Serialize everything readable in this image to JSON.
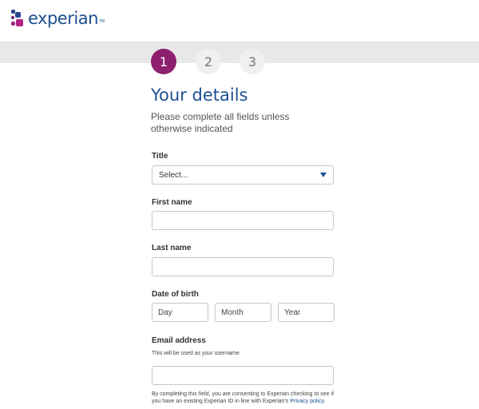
{
  "brand": {
    "name": "experian",
    "trademark": "TM"
  },
  "steps": [
    {
      "label": "1",
      "state": "active"
    },
    {
      "label": "2",
      "state": "inactive"
    },
    {
      "label": "3",
      "state": "inactive"
    }
  ],
  "page": {
    "title": "Your details",
    "subtitle": "Please complete all fields unless otherwise indicated"
  },
  "form": {
    "title_label": "Title",
    "title_select_value": "Select...",
    "first_name_label": "First name",
    "first_name_value": "",
    "last_name_label": "Last name",
    "last_name_value": "",
    "dob_label": "Date of birth",
    "dob_day_placeholder": "Day",
    "dob_month_placeholder": "Month",
    "dob_year_placeholder": "Year",
    "email_label": "Email address",
    "email_hint": "This will be used as your username.",
    "email_value": "",
    "consent_text": "By completing this field, you are consenting to Experian checking to see if you have an existing Experian ID in line with Experian's",
    "privacy_link": "Privacy policy."
  },
  "colors": {
    "brand_blue": "#1d4f91",
    "step_active": "#8e1f6f",
    "step_inactive": "#f0f0f0",
    "band": "#e8e8e8"
  }
}
